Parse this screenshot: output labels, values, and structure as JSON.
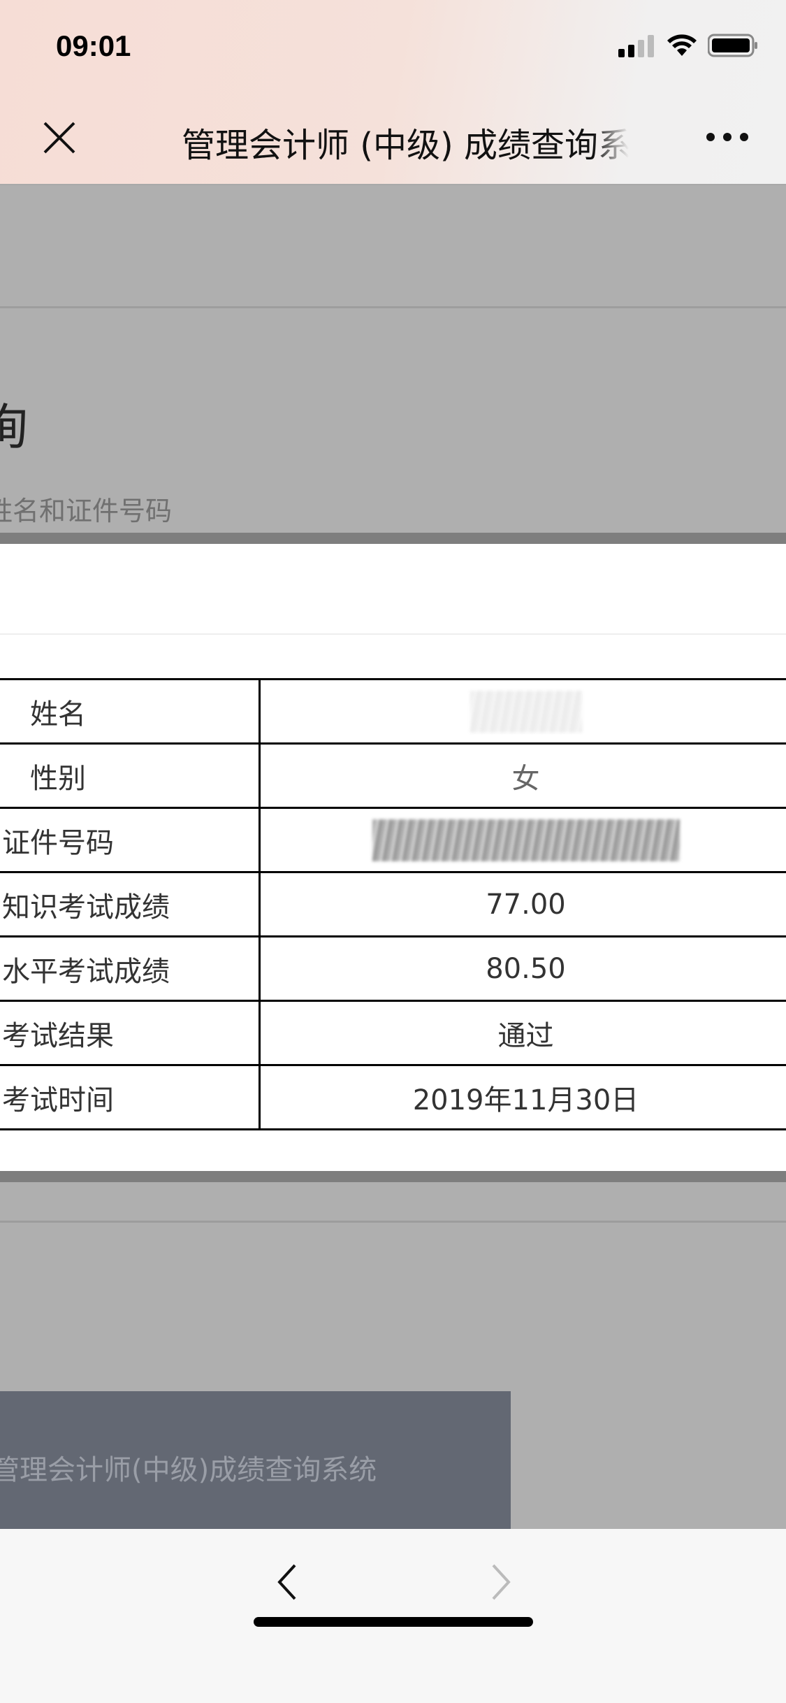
{
  "status_bar": {
    "time": "09:01",
    "icons": [
      "cellular-signal-icon",
      "wifi-icon",
      "battery-icon"
    ]
  },
  "nav": {
    "title": "管理会计师 (中级) 成绩查询系统",
    "close_icon": "close-icon",
    "more_icon": "more-icon"
  },
  "header": {
    "title_fragment": "询",
    "subtitle_fragment": "姓名和证件号码"
  },
  "table": {
    "rows": [
      {
        "label": "姓名",
        "value": null,
        "redacted": true
      },
      {
        "label": "性别",
        "value": "女"
      },
      {
        "label": "证件号码",
        "value": null,
        "redacted": true
      },
      {
        "label": "知识考试成绩",
        "value": "77.00"
      },
      {
        "label": "水平考试成绩",
        "value": "80.50"
      },
      {
        "label": "考试结果",
        "value": "通过"
      },
      {
        "label": "考试时间",
        "value": "2019年11月30日"
      }
    ]
  },
  "footer": {
    "text": "管理会计师(中级)成绩查询系统"
  },
  "toolbar": {
    "back_icon": "chevron-left-icon",
    "forward_icon": "chevron-right-icon"
  }
}
